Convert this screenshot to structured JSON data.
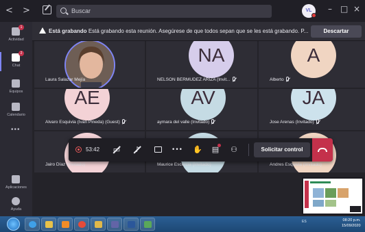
{
  "titlebar": {
    "back_label": "<",
    "forward_label": ">",
    "search_placeholder": "Buscar",
    "user_initials": "VL",
    "minimize_label": "–",
    "maximize_label": "□",
    "close_label": "×"
  },
  "rail": {
    "items": [
      {
        "label": "Actividad",
        "badge": "1"
      },
      {
        "label": "Chat",
        "badge": "2"
      },
      {
        "label": "Equipos",
        "badge": ""
      },
      {
        "label": "Calendario",
        "badge": ""
      }
    ],
    "more_label": "•••",
    "bottom": [
      {
        "label": "Aplicaciones"
      },
      {
        "label": "Ayuda"
      }
    ]
  },
  "banner": {
    "title": "Está grabando",
    "message": "Está grabando esta reunión. Asegúrese de que todos sepan que se les está grabando. P...",
    "dismiss_label": "Descartar"
  },
  "participants": [
    {
      "name": "Laura Salazar Mejía",
      "initials": "",
      "has_photo": true,
      "muted": false
    },
    {
      "name": "NELSON BERMUDEZ ARIZA (Invit...",
      "initials": "NA",
      "color": "#d6cdeb",
      "muted": true
    },
    {
      "name": "Alberto",
      "initials": "A",
      "color": "#f0d5c2",
      "muted": true
    },
    {
      "name": "Alvaro Esquivia (Ivan Pineda) (Guest)",
      "initials": "AE",
      "color": "#f3d2d6",
      "muted": true
    },
    {
      "name": "aymara del valle (Invitado)",
      "initials": "AV",
      "color": "#c5dbe4",
      "muted": true
    },
    {
      "name": "Jose Arenas (Invitado)",
      "initials": "JA",
      "color": "#cde2ec",
      "muted": true
    },
    {
      "name": "Jairo Díaz (Invitado)",
      "initials": "",
      "color": "#f3d2d6",
      "muted": false
    },
    {
      "name": "Maurice Escorcia (Invitado)",
      "initials": "",
      "color": "#c5dbe4",
      "muted": false
    },
    {
      "name": "Andres Esquivia (Invitado)",
      "initials": "",
      "color": "#f0d5c2",
      "muted": false
    }
  ],
  "controls": {
    "timer": "53:42",
    "request_control_label": "Solicitar control",
    "more_label": "•••"
  },
  "taskbar": {
    "clock_time": "08:20 p.m.",
    "clock_date": "15/09/2020",
    "tray_lang": "ES"
  }
}
